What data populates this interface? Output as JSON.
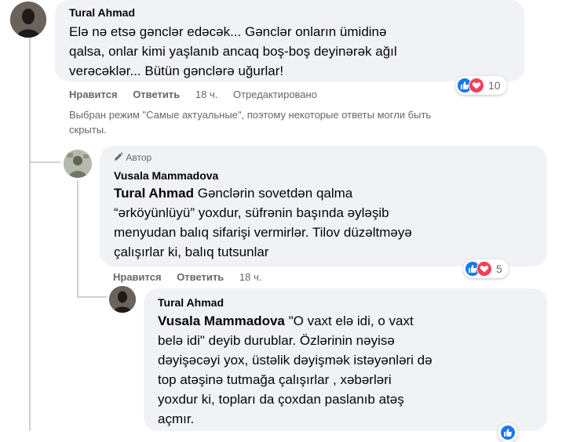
{
  "comments": [
    {
      "author": "Tural Ahmad",
      "text_lines": [
        "Elə nə etsə gənclər edəcək... Gənclər onların ümidinə",
        "qalsa, onlar kimi yaşlanıb ancaq boş-boş deyinərək ağıl",
        "verəcəklər... Bütün gənclərə uğurlar!"
      ],
      "actions": {
        "like": "Нравится",
        "reply": "Ответить",
        "time": "18 ч.",
        "edited": "Отредактировано"
      },
      "reactions": {
        "count": "10",
        "icons": [
          "like-icon",
          "love-icon"
        ]
      }
    },
    {
      "badge": "Автор",
      "author": "Vusala Mammadova",
      "mention": "Tural Ahmad",
      "text_lines": [
        " Gənclərin sovetdən qalma",
        "“ərköyünlüyü” yoxdur, süfrənin başında əyləşib",
        "menyudan balıq sifarişi vermirlər. Tilov düzəltməyə",
        "çalışırlar ki, balıq tutsunlar"
      ],
      "actions": {
        "like": "Нравится",
        "reply": "Ответить",
        "time": "18 ч."
      },
      "reactions": {
        "count": "5",
        "icons": [
          "like-icon",
          "love-icon"
        ]
      }
    },
    {
      "author": "Tural Ahmad",
      "mention": "Vusala Mammadova",
      "text_lines": [
        " \"O vaxt elə idi, o vaxt",
        "belə idi\" deyib durublar. Özlərinin nəyisə",
        "dəyişəcəyi yox, üstəlik dəyişmək istəyənləri də",
        "top atəşinə tutmağa çalışırlar , xəbərləri",
        "yoxdur ki, topları da çoxdan paslanıb atəş",
        "açmır."
      ]
    }
  ],
  "notice_lines": [
    "Выбран режим \"Самые актуальные\", поэтому некоторые ответы могли быть",
    "скрыты."
  ],
  "colors": {
    "bubble": "#f0f2f5",
    "secondary_text": "#65676b",
    "like_blue": "#1877f2",
    "love_red": "#f33e58",
    "thread_line": "#ced0d4"
  }
}
